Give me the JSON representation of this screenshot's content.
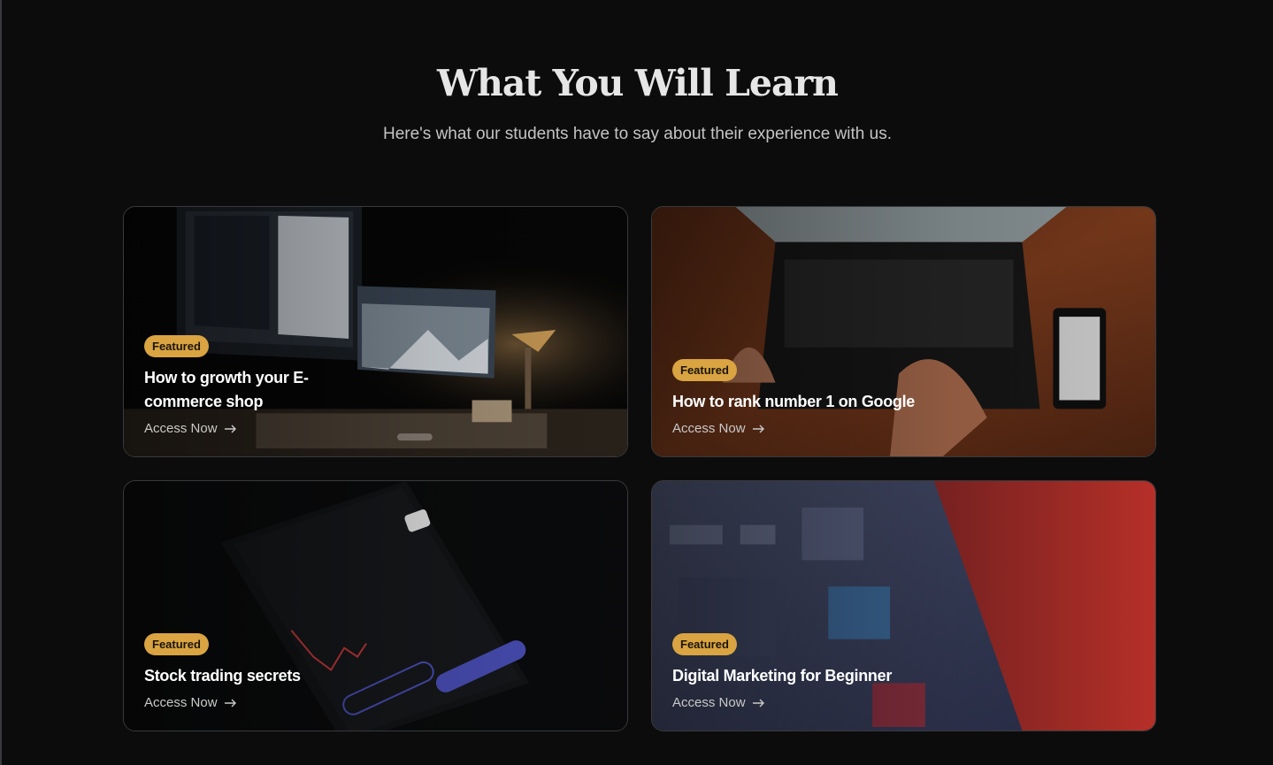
{
  "section": {
    "title": "What You Will Learn",
    "subtitle": "Here's what our students have to say about their experience with us."
  },
  "cards": [
    {
      "badge": "Featured",
      "title": "How to growth your E-commerce shop",
      "link_label": "Access Now",
      "image": "desk-computer-photo"
    },
    {
      "badge": "Featured",
      "title": "How to rank number 1 on Google",
      "link_label": "Access Now",
      "image": "laptop-typing-photo"
    },
    {
      "badge": "Featured",
      "title": "Stock trading secrets",
      "link_label": "Access Now",
      "image": "stock-app-phone-photo"
    },
    {
      "badge": "Featured",
      "title": "Digital Marketing for Beginner",
      "link_label": "Access Now",
      "image": "analytics-tablet-photo"
    }
  ],
  "colors": {
    "background": "#0c0c0d",
    "badge": "#d9a441",
    "card_border": "#3a3a3c"
  },
  "icons": [
    "arrow-right-icon"
  ]
}
